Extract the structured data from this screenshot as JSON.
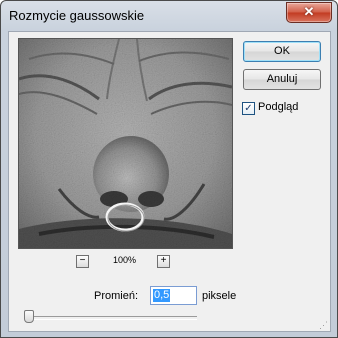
{
  "window": {
    "title": "Rozmycie gaussowskie",
    "close_glyph": "✕"
  },
  "preview": {
    "zoom_label": "100%",
    "zoom_out_glyph": "−",
    "zoom_in_glyph": "+"
  },
  "buttons": {
    "ok_label": "OK",
    "cancel_label": "Anuluj"
  },
  "preview_checkbox": {
    "label": "Podgląd",
    "checked": true,
    "check_glyph": "✓"
  },
  "radius": {
    "label": "Promień:",
    "value": "0,5",
    "unit": "piksele",
    "slider_fraction": 0.0
  },
  "icons": {
    "close": "close-icon",
    "zoom_out": "minus-icon",
    "zoom_in": "plus-icon",
    "check": "checkmark-icon"
  },
  "colors": {
    "titlebar": "#c9d2dd",
    "close_button": "#c23b22",
    "selection": "#3399ff",
    "dialog_bg": "#f0f0f0"
  }
}
